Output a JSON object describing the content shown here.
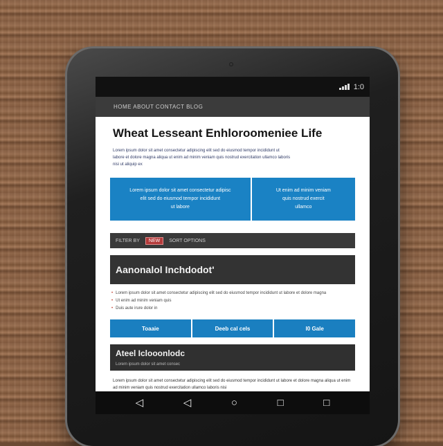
{
  "statusbar": {
    "clock": "1:0"
  },
  "site_nav": {
    "text": "HOME ABOUT CONTACT BLOG"
  },
  "article": {
    "title": "Wheat Lesseant Enhloroomeniee Life",
    "intro_lines": [
      "Lorem ipsum dolor sit amet consectetur adipiscing elit sed do eiusmod tempor incididunt ut",
      "labore et dolore magna aliqua ut enim ad minim veniam quis nostrud exercitation ullamco laboris",
      "nisi ut aliquip ex"
    ]
  },
  "callouts": {
    "left_lines": [
      "Lorem ipsum dolor sit amet consectetur adipisc",
      "elit sed do eiusmod tempor incididunt",
      "ut labore"
    ],
    "right_lines": [
      "Ut enim ad minim veniam",
      "quis nostrud exercit",
      "ullamco"
    ]
  },
  "filterbar": {
    "left": "FILTER BY",
    "badge": "NEW",
    "right": "SORT OPTIONS"
  },
  "section1": {
    "heading": "Aanonalol Inchdodot'",
    "bullets": [
      "Lorem ipsum dolor sit amet consectetur adipiscing elit sed do eiusmod tempor incididunt ut labore et dolore magna",
      "Ut enim ad minim veniam quis",
      "Duis aute irure dolor in"
    ]
  },
  "tabs": [
    "Toaaie",
    "Deeb cal cels",
    "I0 Gale"
  ],
  "section2": {
    "heading": "Ateel Iclooonlodc",
    "sub": "Lorem ipsum dolor sit amet consec"
  },
  "outro": {
    "text": "Lorem ipsum dolor sit amet consectetur adipiscing elit sed do eiusmod tempor incididunt ut labore et dolore magna aliqua ut enim ad minim veniam quis nostrud exercitation ullamco laboris nisi"
  },
  "navbar": {
    "back_glyph": "◁",
    "home_glyph": "○",
    "recents_glyph": "□"
  }
}
